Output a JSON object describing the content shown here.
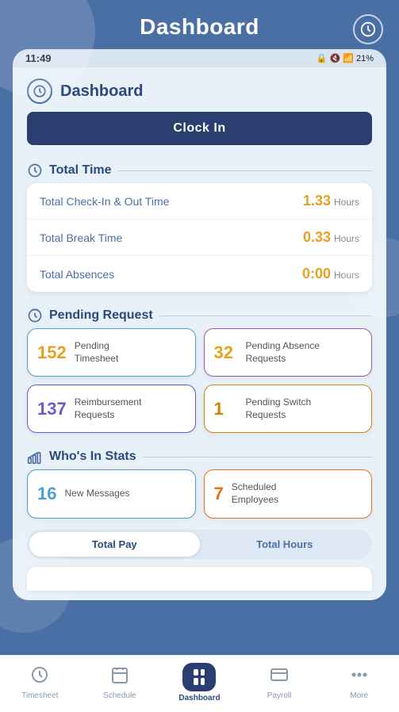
{
  "header": {
    "title": "Dashboard",
    "icon": "⏱"
  },
  "status_bar": {
    "time": "11:49",
    "battery": "21%",
    "signal": "4G"
  },
  "card": {
    "title": "Dashboard",
    "clock_in_label": "Clock In"
  },
  "total_time": {
    "section_title": "Total Time",
    "rows": [
      {
        "label": "Total  Check-In & Out Time",
        "value": "1.33",
        "unit": "Hours"
      },
      {
        "label": "Total  Break Time",
        "value": "0.33",
        "unit": "Hours"
      },
      {
        "label": "Total  Absences",
        "value": "0:00",
        "unit": "Hours"
      }
    ]
  },
  "pending_request": {
    "section_title": "Pending Request",
    "cards": [
      {
        "number": "152",
        "label": "Pending\nTimesheet",
        "style": "blue"
      },
      {
        "number": "32",
        "label": "Pending Absence\nRequests",
        "style": "purple"
      },
      {
        "number": "137",
        "label": "Reimbursement\nRequests",
        "style": "indigo"
      },
      {
        "number": "1",
        "label": "Pending Switch\nRequests",
        "style": "orange"
      }
    ]
  },
  "whos_in_stats": {
    "section_title": "Who's In Stats",
    "cards": [
      {
        "number": "16",
        "label": "New Messages",
        "style": "blue"
      },
      {
        "number": "7",
        "label": "Scheduled\nEmployees",
        "style": "orange"
      }
    ]
  },
  "tabs": [
    {
      "label": "Total Pay",
      "active": true
    },
    {
      "label": "Total Hours",
      "active": false
    }
  ],
  "bottom_nav": [
    {
      "label": "Timesheet",
      "icon": "⏱",
      "active": false
    },
    {
      "label": "Schedule",
      "icon": "📅",
      "active": false
    },
    {
      "label": "Dashboard",
      "icon": "⊞",
      "active": true
    },
    {
      "label": "Payroll",
      "icon": "💳",
      "active": false
    },
    {
      "label": "More",
      "icon": "•••",
      "active": false
    }
  ]
}
